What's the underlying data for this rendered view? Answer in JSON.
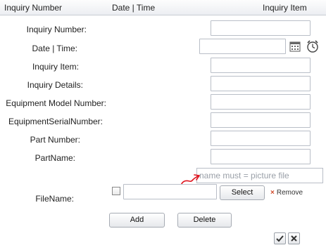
{
  "header": {
    "col1": "Inquiry Number",
    "col2": "Date | Time",
    "col3": "Inquiry Item"
  },
  "form": {
    "inquiry_number_label": "Inquiry Number:",
    "date_time_label": "Date | Time:",
    "inquiry_item_label": "Inquiry Item:",
    "inquiry_details_label": "Inquiry Details:",
    "equipment_model_label": "Equipment Model Number:",
    "equipment_serial_label": "EquipmentSerialNumber:",
    "part_number_label": "Part Number:",
    "part_name_label": "PartName:",
    "filename_label": "FileName:",
    "hint_text": "name must =  picture file",
    "select_label": "Select",
    "remove_label": "Remove",
    "add_label": "Add",
    "delete_label": "Delete"
  },
  "icons": {
    "calendar": "calendar-icon",
    "clock": "clock-icon",
    "remove": "x-icon",
    "ok": "check-icon",
    "cancel": "close-icon"
  },
  "colors": {
    "remove_x": "#d04a2a",
    "annotation": "#e0141e"
  }
}
